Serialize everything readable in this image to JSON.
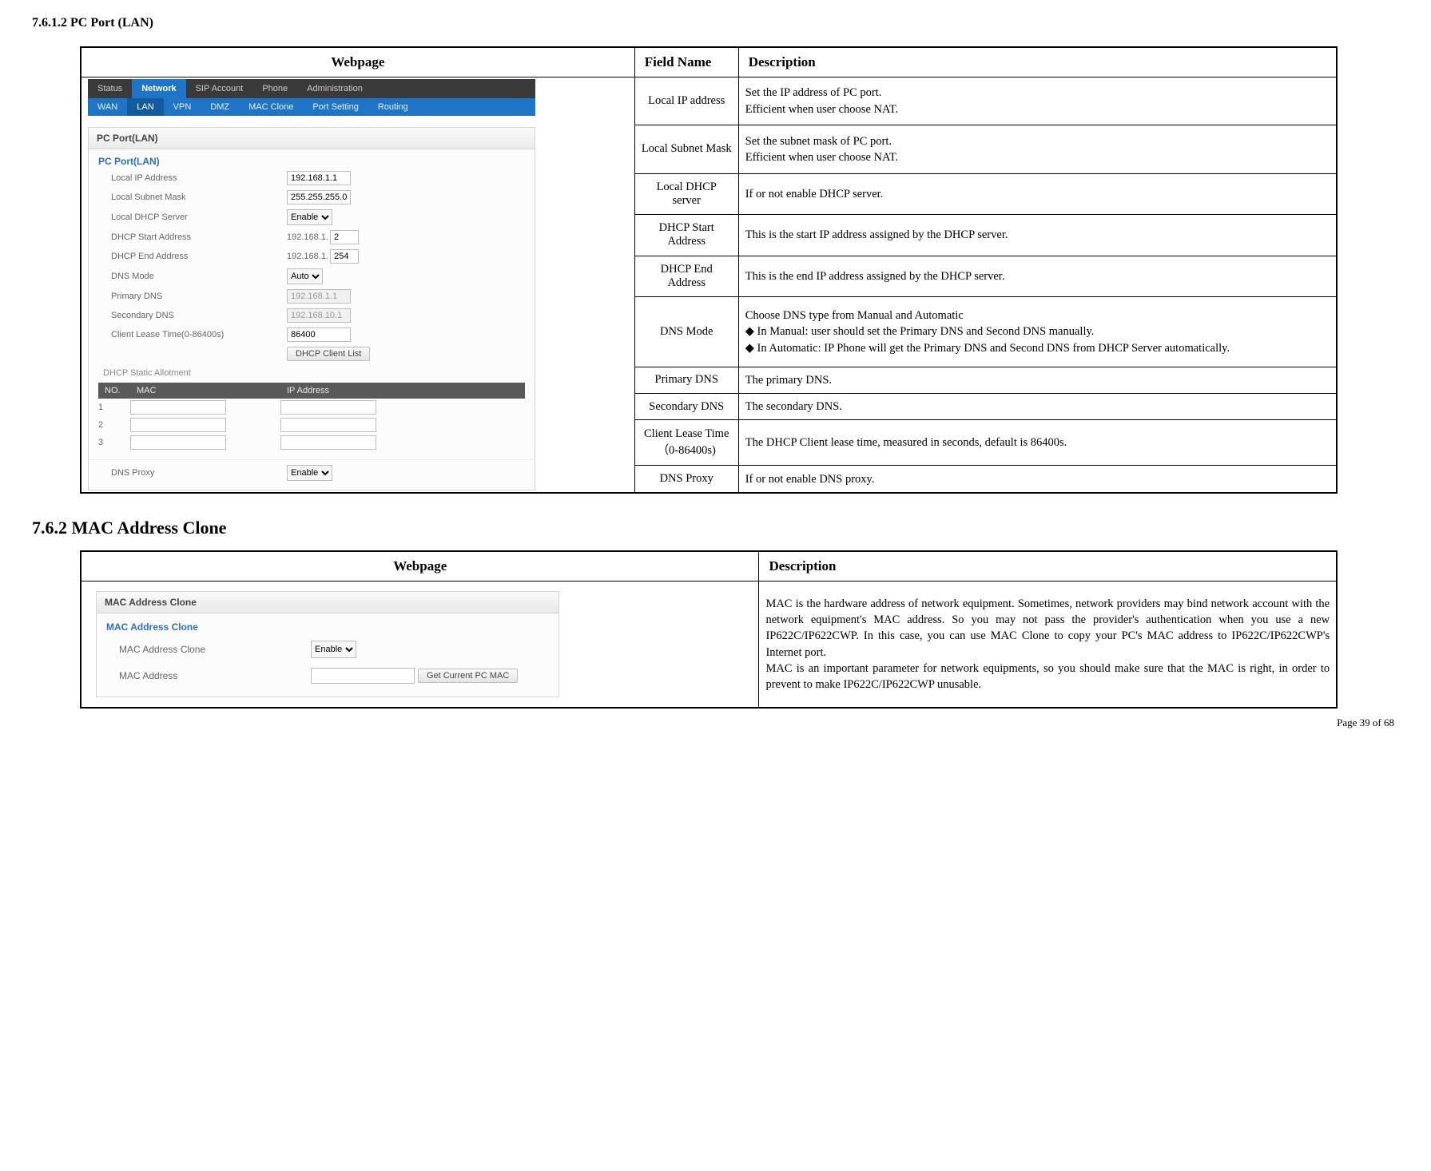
{
  "section1_title": "7.6.1.2  PC Port (LAN)",
  "section2_title": "7.6.2     MAC Address Clone",
  "page_footer": "Page  39  of  68",
  "t1": {
    "head_webpage": "Webpage",
    "head_field": "Field Name",
    "head_desc": "Description",
    "rows": [
      {
        "field": "Local IP address",
        "desc": "Set the IP address of PC port.\nEfficient when user choose NAT."
      },
      {
        "field": "Local Subnet Mask",
        "desc": "Set the subnet mask of PC port.\nEfficient when user choose NAT."
      },
      {
        "field": "Local DHCP server",
        "desc": "If or not enable DHCP server."
      },
      {
        "field": "DHCP Start Address",
        "desc": "This is the start IP address assigned by the DHCP server."
      },
      {
        "field": "DHCP End Address",
        "desc": "This is the end IP address assigned by the DHCP server."
      },
      {
        "field": "DNS Mode",
        "desc": "Choose DNS type from Manual and Automatic\n◆ In Manual: user should set the Primary DNS and Second DNS manually.\n◆ In Automatic: IP Phone will get the Primary DNS and Second DNS from DHCP Server automatically."
      },
      {
        "field": "Primary DNS",
        "desc": "The primary DNS."
      },
      {
        "field": "Secondary DNS",
        "desc": "The secondary DNS."
      },
      {
        "field": "Client Lease Time（0-86400s)",
        "desc": "The DHCP Client lease time, measured in seconds, default is 86400s."
      },
      {
        "field": "DNS Proxy",
        "desc": "If or not enable DNS proxy."
      }
    ]
  },
  "t2": {
    "head_webpage": "Webpage",
    "head_desc": "Description",
    "desc": "MAC is the hardware address of network equipment. Sometimes, network providers may bind network account with the network equipment's MAC address. So you may not pass the provider's authentication when you use a new IP622C/IP622CWP. In this case, you can use MAC Clone to copy your PC's MAC address to IP622C/IP622CWP's Internet port.\nMAC is an important parameter for network equipments, so you should make sure that the MAC is right, in order to prevent to make IP622C/IP622CWP unusable."
  },
  "ui1": {
    "top_tabs": [
      "Status",
      "Network",
      "SIP Account",
      "Phone",
      "Administration"
    ],
    "top_active": "Network",
    "sub_tabs": [
      "WAN",
      "LAN",
      "VPN",
      "DMZ",
      "MAC Clone",
      "Port Setting",
      "Routing"
    ],
    "sub_active": "LAN",
    "panel_title": "PC Port(LAN)",
    "panel_sub": "PC Port(LAN)",
    "labels": {
      "local_ip": "Local IP Address",
      "subnet": "Local Subnet Mask",
      "dhcp_server": "Local DHCP Server",
      "dhcp_start": "DHCP Start Address",
      "dhcp_end": "DHCP End Address",
      "dns_mode": "DNS Mode",
      "pri_dns": "Primary DNS",
      "sec_dns": "Secondary DNS",
      "lease": "Client Lease Time(0-86400s)",
      "dns_proxy": "DNS Proxy",
      "allot_title": "DHCP Static Allotment",
      "btn_list": "DHCP Client List"
    },
    "values": {
      "local_ip": "192.168.1.1",
      "subnet": "255.255.255.0",
      "dhcp_server": "Enable",
      "dhcp_prefix": "192.168.1.",
      "dhcp_start": "2",
      "dhcp_end": "254",
      "dns_mode": "Auto",
      "pri_dns": "192.168.1.1",
      "sec_dns": "192.168.10.1",
      "lease": "86400",
      "dns_proxy": "Enable"
    },
    "allot_head": {
      "no": "NO.",
      "mac": "MAC",
      "ip": "IP Address"
    },
    "allot_rows": [
      "1",
      "2",
      "3"
    ]
  },
  "ui2": {
    "panel_title": "MAC Address Clone",
    "panel_sub": "MAC Address Clone",
    "label_clone": "MAC Address Clone",
    "label_mac": "MAC Address",
    "value_clone": "Enable",
    "btn_text": "Get Current PC MAC"
  }
}
